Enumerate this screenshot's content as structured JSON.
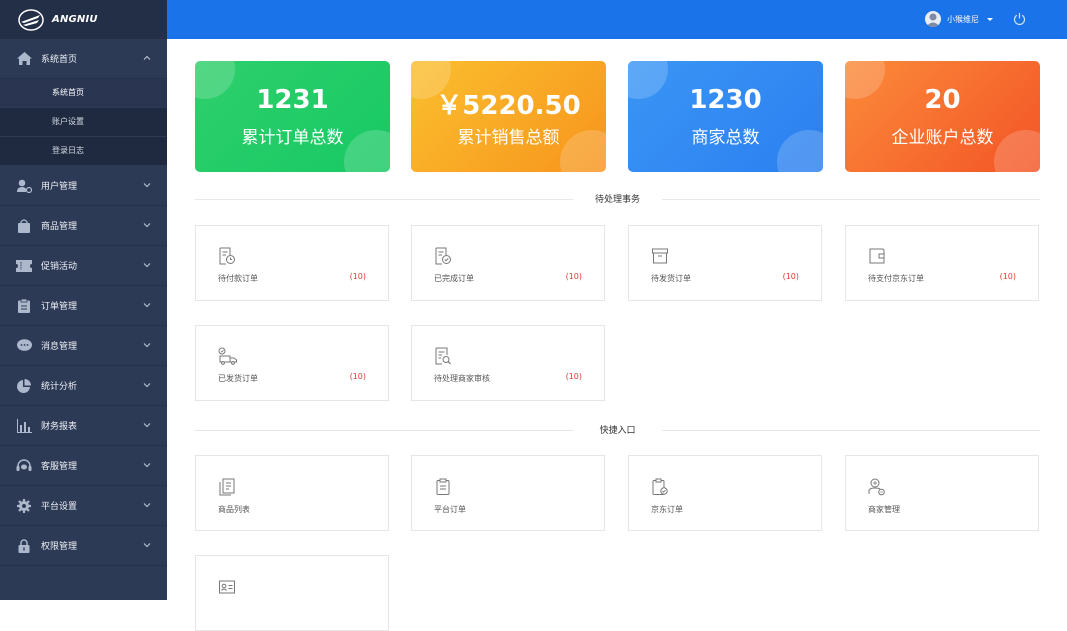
{
  "brand": {
    "name": "ANGNIU"
  },
  "sidebar": {
    "items": [
      {
        "label": "系统首页",
        "icon": "home-icon",
        "expanded": true,
        "children": [
          {
            "label": "系统首页",
            "active": true
          },
          {
            "label": "账户设置"
          },
          {
            "label": "登录日志"
          }
        ]
      },
      {
        "label": "用户管理",
        "icon": "user-gear-icon"
      },
      {
        "label": "商品管理",
        "icon": "shopping-bag-icon"
      },
      {
        "label": "促销活动",
        "icon": "coupon-icon"
      },
      {
        "label": "订单管理",
        "icon": "clipboard-icon"
      },
      {
        "label": "消息管理",
        "icon": "chat-icon"
      },
      {
        "label": "统计分析",
        "icon": "pie-chart-icon"
      },
      {
        "label": "财务报表",
        "icon": "bar-chart-icon"
      },
      {
        "label": "客服管理",
        "icon": "headset-icon"
      },
      {
        "label": "平台设置",
        "icon": "gear-icon"
      },
      {
        "label": "权限管理",
        "icon": "lock-icon"
      }
    ]
  },
  "header": {
    "username": "小猴维尼"
  },
  "stats": [
    {
      "value": "1231",
      "label": "累计订单总数",
      "color_from": "#2ecf6b",
      "color_to": "#17c964"
    },
    {
      "value": "￥5220.50",
      "label": "累计销售总额",
      "color_from": "#fbbf2e",
      "color_to": "#f7941d"
    },
    {
      "value": "1230",
      "label": "商家总数",
      "color_from": "#3a96f5",
      "color_to": "#2b7ff0"
    },
    {
      "value": "20",
      "label": "企业账户总数",
      "color_from": "#fb8b3a",
      "color_to": "#f35426"
    }
  ],
  "pending": {
    "title": "待处理事务",
    "items": [
      {
        "label": "待付款订单",
        "count": "(10)",
        "icon": "order-clock-icon"
      },
      {
        "label": "已完成订单",
        "count": "(10)",
        "icon": "order-check-icon"
      },
      {
        "label": "待发货订单",
        "count": "(10)",
        "icon": "box-icon"
      },
      {
        "label": "待支付京东订单",
        "count": "(10)",
        "icon": "wallet-icon"
      },
      {
        "label": "已发货订单",
        "count": "(10)",
        "icon": "truck-icon"
      },
      {
        "label": "待处理商家审核",
        "count": "(10)",
        "icon": "audit-search-icon"
      }
    ]
  },
  "shortcuts": {
    "title": "快捷入口",
    "items": [
      {
        "label": "商品列表",
        "icon": "product-list-icon"
      },
      {
        "label": "平台订单",
        "icon": "platform-order-icon"
      },
      {
        "label": "京东订单",
        "icon": "jd-order-icon"
      },
      {
        "label": "商家管理",
        "icon": "merchant-icon"
      },
      {
        "label": "",
        "icon": "id-card-icon"
      }
    ]
  }
}
